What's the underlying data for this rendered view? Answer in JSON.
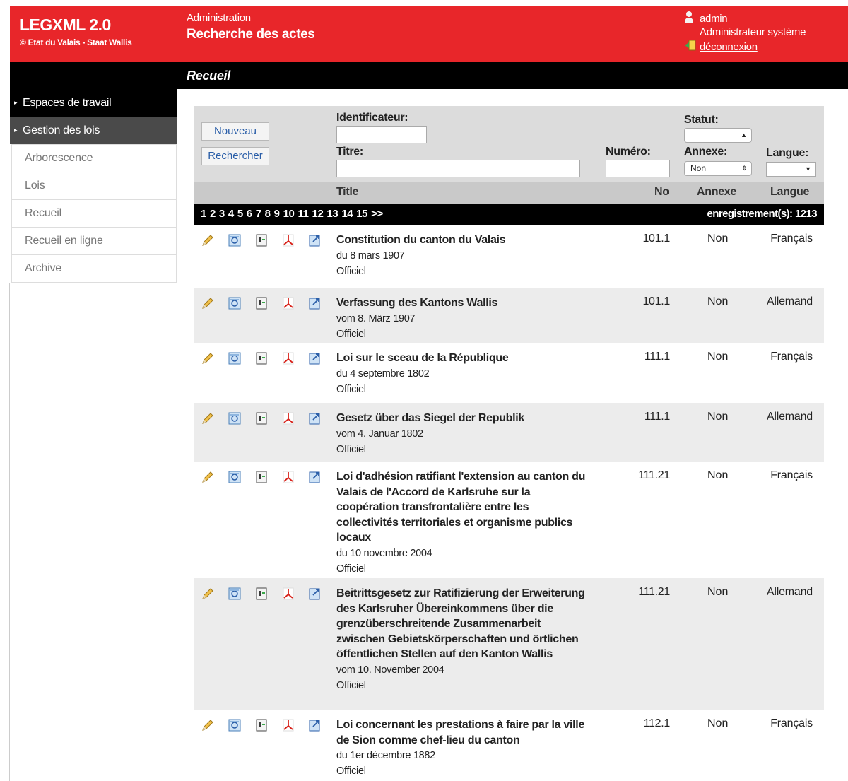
{
  "header": {
    "app_title": "LEGXML 2.0",
    "app_subtitle": "© Etat du Valais - Staat Wallis",
    "section": "Administration",
    "page_title": "Recherche des actes",
    "user_name": "admin",
    "user_role": "Administrateur système",
    "logout_label": "déconnexion"
  },
  "bar": {
    "title": "Recueil"
  },
  "sidebar": {
    "groups": [
      {
        "label": "Espaces de travail"
      },
      {
        "label": "Gestion des lois"
      }
    ],
    "items": [
      {
        "label": "Arborescence"
      },
      {
        "label": "Lois"
      },
      {
        "label": "Recueil"
      },
      {
        "label": "Recueil en ligne"
      },
      {
        "label": "Archive"
      }
    ]
  },
  "search": {
    "new_button": "Nouveau",
    "search_button": "Rechercher",
    "identifier_label": "Identificateur:",
    "identifier_value": "",
    "title_label": "Titre:",
    "title_value": "",
    "number_label": "Numéro:",
    "number_value": "",
    "status_label": "Statut:",
    "status_value": "",
    "annex_label": "Annexe:",
    "annex_value": "Non",
    "language_label": "Langue:",
    "language_value": ""
  },
  "table": {
    "headers": {
      "title": "Title",
      "no": "No",
      "annex": "Annexe",
      "language": "Langue"
    },
    "pages": [
      "1",
      "2",
      "3",
      "4",
      "5",
      "6",
      "7",
      "8",
      "9",
      "10",
      "11",
      "12",
      "13",
      "14",
      "15",
      ">>"
    ],
    "current_page": "1",
    "record_label": "enregistrement(s):",
    "record_count": "1213",
    "rows": [
      {
        "title": "Constitution du canton du Valais",
        "date": "du 8 mars 1907",
        "status": "Officiel",
        "no": "101.1",
        "annex": "Non",
        "language": "Français"
      },
      {
        "title": "Verfassung des Kantons Wallis",
        "date": "vom 8. März 1907",
        "status": "Officiel",
        "no": "101.1",
        "annex": "Non",
        "language": "Allemand"
      },
      {
        "title": "Loi sur le sceau de la République",
        "date": "du 4 septembre 1802",
        "status": "Officiel",
        "no": "111.1",
        "annex": "Non",
        "language": "Français"
      },
      {
        "title": "Gesetz über das Siegel der Republik",
        "date": "vom 4. Januar 1802",
        "status": "Officiel",
        "no": "111.1",
        "annex": "Non",
        "language": "Allemand"
      },
      {
        "title": "Loi d'adhésion ratifiant l'extension au canton du Valais de l'Accord de Karlsruhe sur la coopération transfrontalière entre les collectivités territoriales et organisme publics locaux",
        "date": "du 10 novembre 2004",
        "status": "Officiel",
        "no": "111.21",
        "annex": "Non",
        "language": "Français"
      },
      {
        "title": "Beitrittsgesetz zur Ratifizierung der Erweiterung des Karlsruher Übereinkommens über die grenzüberschreitende Zusammenarbeit zwischen Gebietskörperschaften und örtlichen öffentlichen Stellen auf den Kanton Wallis",
        "date": "vom 10. November 2004",
        "status": "Officiel",
        "no": "111.21",
        "annex": "Non",
        "language": "Allemand"
      },
      {
        "title": "Loi concernant les prestations à faire par la ville de Sion comme chef-lieu du canton",
        "date": "du 1er décembre 1882",
        "status": "Officiel",
        "no": "112.1",
        "annex": "Non",
        "language": "Français"
      }
    ]
  },
  "icons": {
    "row_actions": [
      "edit-pencil-icon",
      "view-document-icon",
      "xml-document-icon",
      "pdf-icon",
      "export-document-icon"
    ]
  },
  "colors": {
    "header_red": "#e8262a",
    "bar_black": "#000000",
    "link_blue": "#2a5ea8"
  }
}
